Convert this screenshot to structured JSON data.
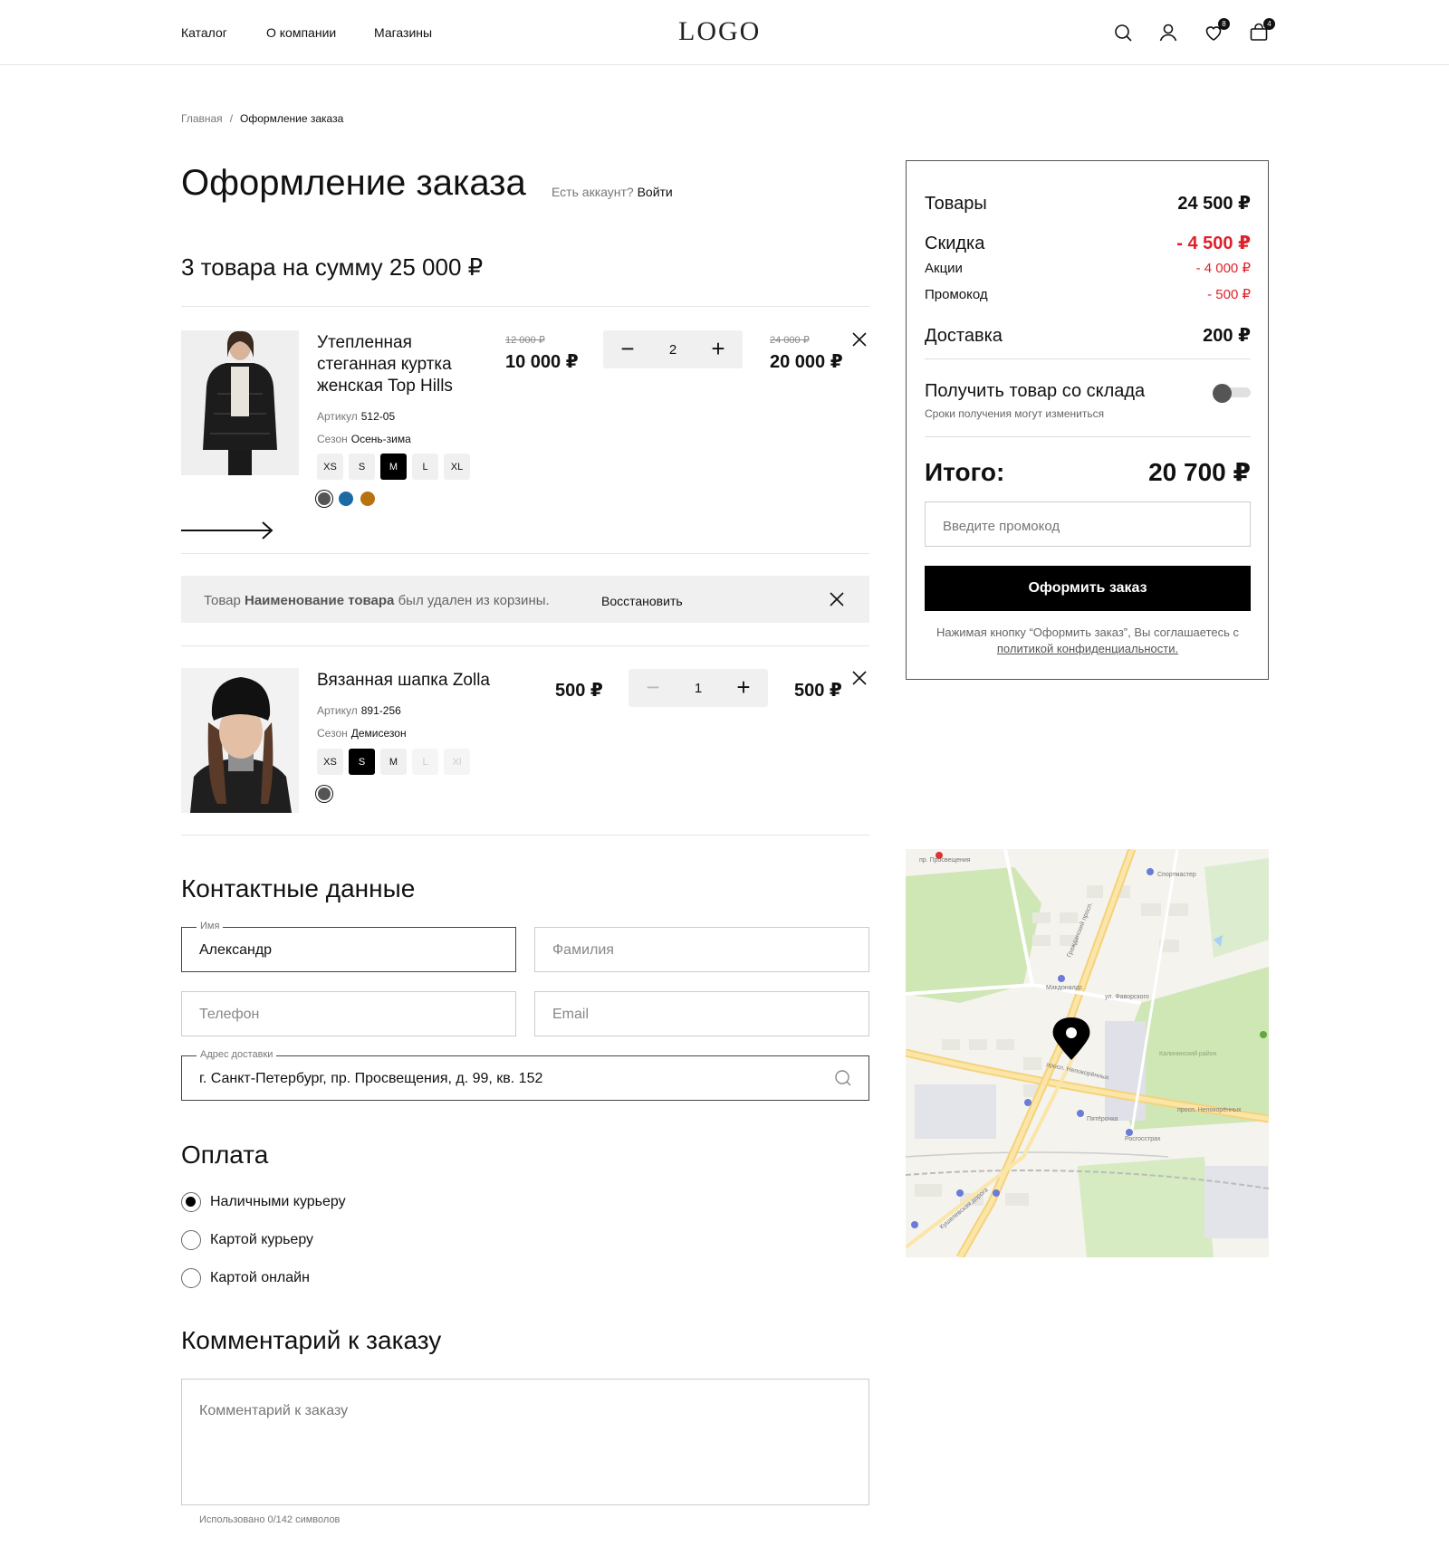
{
  "header": {
    "nav": [
      "Каталог",
      "О компании",
      "Магазины"
    ],
    "logo": "LOGO",
    "favorites_count": "8",
    "cart_count": "4"
  },
  "breadcrumb": {
    "home": "Главная",
    "sep": "/",
    "current": "Оформление заказа"
  },
  "page": {
    "title": "Оформление заказа",
    "login_prompt": "Есть аккаунт?",
    "login_link": "Войти",
    "count_title": "3 товара на сумму 25 000 ₽"
  },
  "products": [
    {
      "name": "Утепленная стеганная куртка женская Top Hills",
      "article_label": "Артикул",
      "article": "512-05",
      "season_label": "Сезон",
      "season": "Осень-зима",
      "sizes": [
        "XS",
        "S",
        "M",
        "L",
        "XL"
      ],
      "selected_size": "M",
      "colors": [
        "#555555",
        "#1b6aa5",
        "#b8730e"
      ],
      "old_price": "12 000 ₽",
      "price": "10 000 ₽",
      "qty": "2",
      "minus": "−",
      "plus": "+",
      "old_total": "24 000 ₽",
      "total": "20 000 ₽"
    },
    {
      "name": "Вязанная шапка Zolla",
      "article_label": "Артикул",
      "article": "891-256",
      "season_label": "Сезон",
      "season": "Демисезон",
      "sizes": [
        "XS",
        "S",
        "M",
        "L",
        "Xl"
      ],
      "selected_size": "S",
      "colors": [
        "#555555"
      ],
      "price": "500 ₽",
      "qty": "1",
      "minus": "−",
      "plus": "+",
      "total": "500 ₽"
    }
  ],
  "removed_notice": {
    "prefix": "Товар",
    "name": "Наименование товара",
    "suffix": "был удален из корзины.",
    "restore": "Восстановить"
  },
  "contacts": {
    "title": "Контактные данные",
    "name_label": "Имя",
    "name_value": "Александр",
    "surname_placeholder": "Фамилия",
    "phone_placeholder": "Телефон",
    "email_placeholder": "Email",
    "address_label": "Адрес доставки",
    "address_value": "г. Санкт-Петербург, пр. Просвещения, д. 99, кв. 152"
  },
  "payment": {
    "title": "Оплата",
    "options": [
      "Наличными курьеру",
      "Картой курьеру",
      "Картой онлайн"
    ],
    "selected": 0
  },
  "comment": {
    "title": "Комментарий к заказу",
    "placeholder": "Комментарий к заказу",
    "counter": "Использовано 0/142 символов"
  },
  "summary": {
    "goods_label": "Товары",
    "goods_value": "24 500 ₽",
    "discount_label": "Скидка",
    "discount_value": "- 4 500 ₽",
    "promo_actions_label": "Акции",
    "promo_actions_value": "- 4 000 ₽",
    "promocode_label": "Промокод",
    "promocode_value": "- 500 ₽",
    "delivery_label": "Доставка",
    "delivery_value": "200 ₽",
    "pickup_label": "Получить товар со склада",
    "pickup_note": "Сроки получения могут измениться",
    "pickup_enabled": false,
    "total_label": "Итого:",
    "total_value": "20 700 ₽",
    "promo_placeholder": "Введите промокод",
    "checkout_button": "Оформить заказ",
    "agree_text": "Нажимая кнопку “Оформить заказ”, Вы соглашаетесь с",
    "agree_link": "политикой конфиденциальности."
  },
  "map": {
    "streets": [
      "пр. Просвещения",
      "просп. Непокорённых",
      "Кушелевская дорога",
      "ул. Фаворского",
      "Гражданский просп.",
      "Калининский район"
    ],
    "pois": [
      "Спортмастер",
      "Макдоналдс",
      "Пятёрочка",
      "Росгосстрах"
    ]
  },
  "colors": {
    "accent": "#000000",
    "discount": "#e0212b",
    "border": "#cccccc"
  }
}
